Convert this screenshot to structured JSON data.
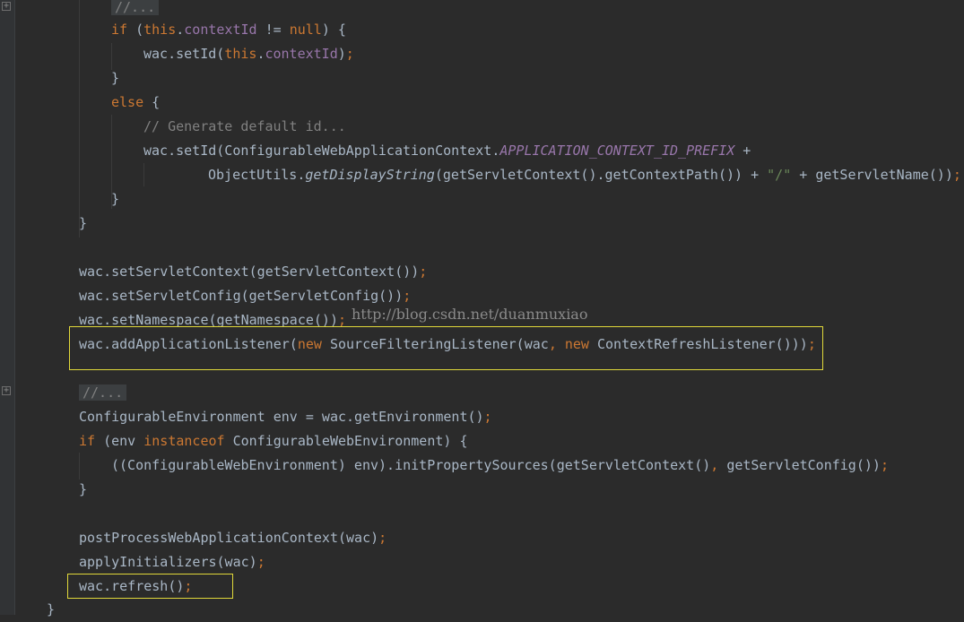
{
  "editor": {
    "lines": [
      {
        "id": "collapsed-comment-1",
        "tokens": [
          {
            "t": "//...",
            "c": "fold-comment"
          }
        ]
      },
      {
        "id": "if-context-id",
        "tokens": [
          {
            "t": "if",
            "c": "k"
          },
          {
            "t": " (",
            "c": ""
          },
          {
            "t": "this",
            "c": "k"
          },
          {
            "t": ".",
            "c": ""
          },
          {
            "t": "contextId",
            "c": "f"
          },
          {
            "t": " != ",
            "c": ""
          },
          {
            "t": "null",
            "c": "k"
          },
          {
            "t": ") {",
            "c": ""
          }
        ]
      },
      {
        "id": "set-id-context-id",
        "tokens": [
          {
            "t": "wac.setId(",
            "c": ""
          },
          {
            "t": "this",
            "c": "k"
          },
          {
            "t": ".",
            "c": ""
          },
          {
            "t": "contextId",
            "c": "f"
          },
          {
            "t": ")",
            "c": ""
          },
          {
            "t": ";",
            "c": "p"
          }
        ]
      },
      {
        "id": "close-brace-if",
        "tokens": [
          {
            "t": "}",
            "c": ""
          }
        ]
      },
      {
        "id": "else-line",
        "tokens": [
          {
            "t": "else",
            "c": "k"
          },
          {
            "t": " {",
            "c": ""
          }
        ]
      },
      {
        "id": "generate-id-comment",
        "tokens": [
          {
            "t": "// Generate default id...",
            "c": "c"
          }
        ]
      },
      {
        "id": "set-id-prefix",
        "tokens": [
          {
            "t": "wac.setId(ConfigurableWebApplicationContext.",
            "c": ""
          },
          {
            "t": "APPLICATION_CONTEXT_ID_PREFIX",
            "c": "st"
          },
          {
            "t": " +",
            "c": ""
          }
        ]
      },
      {
        "id": "object-utils-line",
        "tokens": [
          {
            "t": "ObjectUtils.",
            "c": ""
          },
          {
            "t": "getDisplayString",
            "c": "it"
          },
          {
            "t": "(getServletContext().getContextPath()) + ",
            "c": ""
          },
          {
            "t": "\"/\"",
            "c": "s"
          },
          {
            "t": " + getServletName())",
            "c": ""
          },
          {
            "t": ";",
            "c": "p"
          }
        ]
      },
      {
        "id": "close-brace-else",
        "tokens": [
          {
            "t": "}",
            "c": ""
          }
        ]
      },
      {
        "id": "close-brace-outer",
        "tokens": [
          {
            "t": "}",
            "c": ""
          }
        ]
      },
      {
        "id": "blank-1",
        "tokens": []
      },
      {
        "id": "set-servlet-context",
        "tokens": [
          {
            "t": "wac.setServletContext(getServletContext())",
            "c": ""
          },
          {
            "t": ";",
            "c": "p"
          }
        ]
      },
      {
        "id": "set-servlet-config",
        "tokens": [
          {
            "t": "wac.setServletConfig(getServletConfig())",
            "c": ""
          },
          {
            "t": ";",
            "c": "p"
          }
        ]
      },
      {
        "id": "set-namespace",
        "tokens": [
          {
            "t": "wac.setNamespace(getNamespace())",
            "c": ""
          },
          {
            "t": ";",
            "c": "p"
          }
        ]
      },
      {
        "id": "add-application-listener",
        "tokens": [
          {
            "t": "wac.addApplicationListener(",
            "c": ""
          },
          {
            "t": "new",
            "c": "k"
          },
          {
            "t": " SourceFilteringListener(wac",
            "c": ""
          },
          {
            "t": ", ",
            "c": "p"
          },
          {
            "t": "new",
            "c": "k"
          },
          {
            "t": " ContextRefreshListener()))",
            "c": ""
          },
          {
            "t": ";",
            "c": "p"
          }
        ]
      },
      {
        "id": "blank-2",
        "tokens": []
      },
      {
        "id": "collapsed-comment-2",
        "tokens": [
          {
            "t": "//...",
            "c": "fold-comment"
          }
        ]
      },
      {
        "id": "get-environment",
        "tokens": [
          {
            "t": "ConfigurableEnvironment env = wac.getEnvironment()",
            "c": ""
          },
          {
            "t": ";",
            "c": "p"
          }
        ]
      },
      {
        "id": "if-instanceof",
        "tokens": [
          {
            "t": "if",
            "c": "k"
          },
          {
            "t": " (env ",
            "c": ""
          },
          {
            "t": "instanceof",
            "c": "k"
          },
          {
            "t": " ConfigurableWebEnvironment) {",
            "c": ""
          }
        ]
      },
      {
        "id": "init-property-sources",
        "tokens": [
          {
            "t": "((ConfigurableWebEnvironment) env).initPropertySources(getServletContext()",
            "c": ""
          },
          {
            "t": ", ",
            "c": "p"
          },
          {
            "t": "getServletConfig())",
            "c": ""
          },
          {
            "t": ";",
            "c": "p"
          }
        ]
      },
      {
        "id": "close-brace-if-env",
        "tokens": [
          {
            "t": "}",
            "c": ""
          }
        ]
      },
      {
        "id": "blank-3",
        "tokens": []
      },
      {
        "id": "post-process",
        "tokens": [
          {
            "t": "postProcessWebApplicationContext(wac)",
            "c": ""
          },
          {
            "t": ";",
            "c": "p"
          }
        ]
      },
      {
        "id": "apply-initializers",
        "tokens": [
          {
            "t": "applyInitializers(wac)",
            "c": ""
          },
          {
            "t": ";",
            "c": "p"
          }
        ]
      },
      {
        "id": "wac-refresh",
        "tokens": [
          {
            "t": "wac.refresh()",
            "c": ""
          },
          {
            "t": ";",
            "c": "p"
          }
        ]
      }
    ],
    "closing_brace": "}"
  },
  "watermark": "http://blog.csdn.net/duanmuxiao",
  "gutter": {
    "fold_icons": [
      "fold-plus-icon",
      "fold-plus-icon"
    ]
  },
  "colors": {
    "background": "#2b2b2b",
    "text": "#a9b7c6",
    "keyword": "#cc7832",
    "field": "#9876aa",
    "comment": "#808080",
    "string": "#6a8759",
    "highlight_box": "#e0d83a"
  }
}
